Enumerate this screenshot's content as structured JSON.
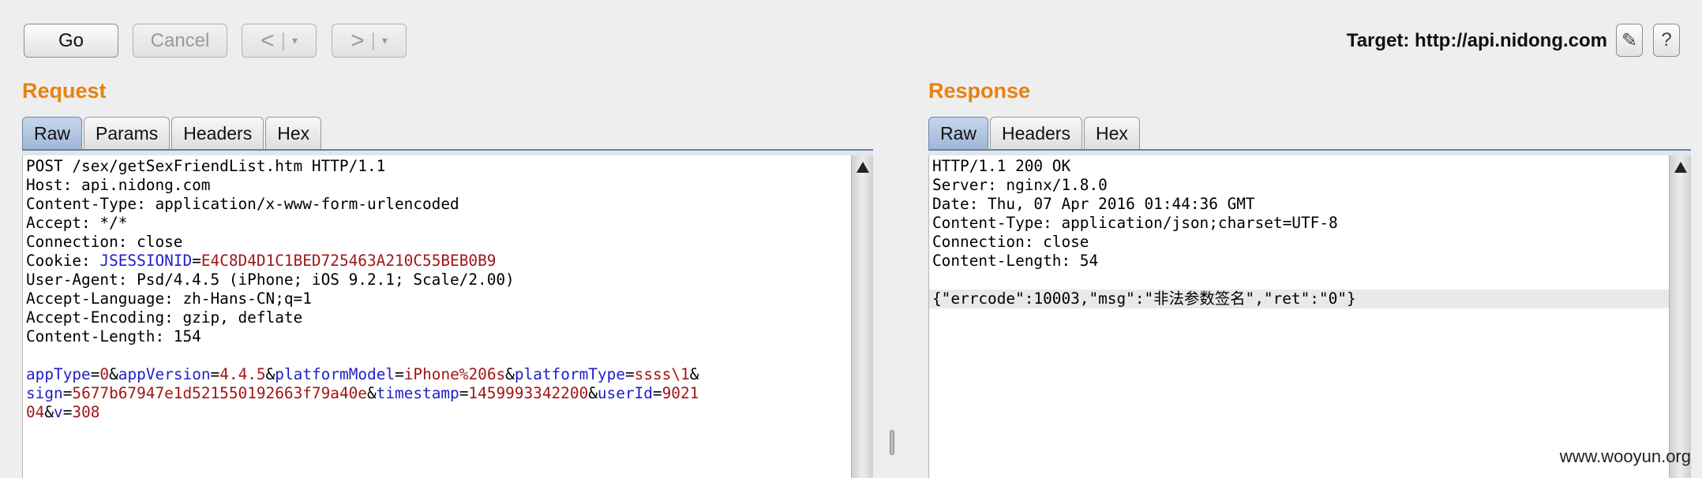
{
  "toolbar": {
    "go_label": "Go",
    "cancel_label": "Cancel",
    "back_label": "<",
    "forward_label": ">",
    "dropdown_glyph": "▾",
    "separator": "|",
    "target_label": "Target: http://api.nidong.com",
    "edit_icon": "✎",
    "help_label": "?"
  },
  "request": {
    "title": "Request",
    "tabs": [
      {
        "label": "Raw",
        "active": true
      },
      {
        "label": "Params",
        "active": false
      },
      {
        "label": "Headers",
        "active": false
      },
      {
        "label": "Hex",
        "active": false
      }
    ],
    "lines": [
      [
        {
          "t": "POST /sex/getSexFriendList.htm HTTP/1.1"
        }
      ],
      [
        {
          "t": "Host: api.nidong.com"
        }
      ],
      [
        {
          "t": "Content-Type: application/x-www-form-urlencoded"
        }
      ],
      [
        {
          "t": "Accept: */*"
        }
      ],
      [
        {
          "t": "Connection: close"
        }
      ],
      [
        {
          "t": "Cookie: "
        },
        {
          "t": "JSESSIONID",
          "c": "k"
        },
        {
          "t": "="
        },
        {
          "t": "E4C8D4D1C1BED725463A210C55BEB0B9",
          "c": "v"
        }
      ],
      [
        {
          "t": "User-Agent: Psd/4.4.5 (iPhone; iOS 9.2.1; Scale/2.00)"
        }
      ],
      [
        {
          "t": "Accept-Language: zh-Hans-CN;q=1"
        }
      ],
      [
        {
          "t": "Accept-Encoding: gzip, deflate"
        }
      ],
      [
        {
          "t": "Content-Length: 154"
        }
      ],
      [
        {
          "t": ""
        }
      ],
      [
        {
          "t": "appType",
          "c": "k"
        },
        {
          "t": "="
        },
        {
          "t": "0",
          "c": "v"
        },
        {
          "t": "&"
        },
        {
          "t": "appVersion",
          "c": "k"
        },
        {
          "t": "="
        },
        {
          "t": "4.4.5",
          "c": "v"
        },
        {
          "t": "&"
        },
        {
          "t": "platformModel",
          "c": "k"
        },
        {
          "t": "="
        },
        {
          "t": "iPhone%206s",
          "c": "v"
        },
        {
          "t": "&"
        },
        {
          "t": "platformType",
          "c": "k"
        },
        {
          "t": "="
        },
        {
          "t": "ssss\\1",
          "c": "v"
        },
        {
          "t": "&"
        }
      ],
      [
        {
          "t": "sign",
          "c": "k"
        },
        {
          "t": "="
        },
        {
          "t": "5677b67947e1d521550192663f79a40e",
          "c": "v"
        },
        {
          "t": "&"
        },
        {
          "t": "timestamp",
          "c": "k"
        },
        {
          "t": "="
        },
        {
          "t": "1459993342200",
          "c": "v"
        },
        {
          "t": "&"
        },
        {
          "t": "userId",
          "c": "k"
        },
        {
          "t": "="
        },
        {
          "t": "9021",
          "c": "v"
        }
      ],
      [
        {
          "t": "04",
          "c": "v"
        },
        {
          "t": "&"
        },
        {
          "t": "v",
          "c": "k"
        },
        {
          "t": "="
        },
        {
          "t": "308",
          "c": "v"
        }
      ]
    ]
  },
  "response": {
    "title": "Response",
    "tabs": [
      {
        "label": "Raw",
        "active": true
      },
      {
        "label": "Headers",
        "active": false
      },
      {
        "label": "Hex",
        "active": false
      }
    ],
    "lines": [
      [
        {
          "t": "HTTP/1.1 200 OK"
        }
      ],
      [
        {
          "t": "Server: nginx/1.8.0"
        }
      ],
      [
        {
          "t": "Date: Thu, 07 Apr 2016 01:44:36 GMT"
        }
      ],
      [
        {
          "t": "Content-Type: application/json;charset=UTF-8"
        }
      ],
      [
        {
          "t": "Connection: close"
        }
      ],
      [
        {
          "t": "Content-Length: 54"
        }
      ],
      [
        {
          "t": ""
        }
      ],
      [
        {
          "t": "{\"errcode\":10003,\"msg\":\"非法参数签名\",\"ret\":\"0\"}"
        }
      ]
    ],
    "highlighted_line": 7
  },
  "watermark": "www.wooyun.org"
}
